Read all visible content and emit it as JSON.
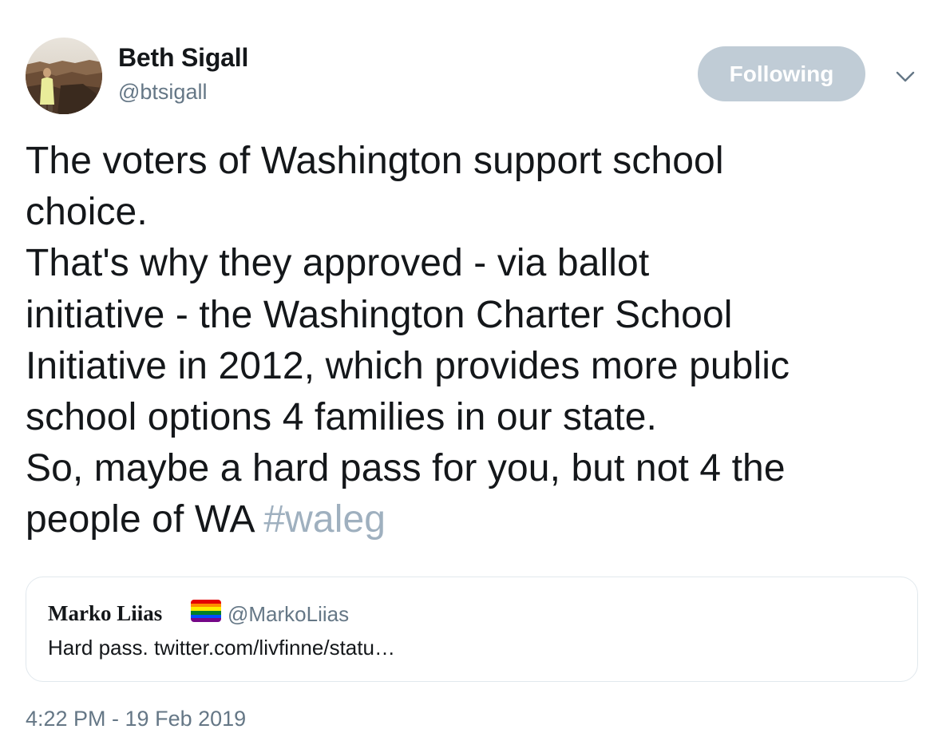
{
  "author": {
    "name": "Beth Sigall",
    "handle": "@btsigall"
  },
  "follow_button": {
    "label": "Following"
  },
  "menu": {
    "icon": "chevron-down-icon"
  },
  "tweet": {
    "lines": [
      "The voters of Washington support school",
      "choice.",
      "That's why they approved - via ballot",
      "initiative - the Washington Charter School",
      "Initiative in 2012, which provides more public",
      "school options 4 families in our state.",
      "So, maybe a hard pass for you, but not 4 the"
    ],
    "last_line_text": "people of WA ",
    "hashtag": "#waleg"
  },
  "quoted_tweet": {
    "name": "Marko Liias",
    "flag_icon": "rainbow-flag-icon",
    "handle": "@MarkoLiias",
    "text": "Hard pass. twitter.com/livfinne/statu…"
  },
  "timestamp": "4:22 PM - 19 Feb 2019",
  "colors": {
    "text": "#14171a",
    "secondary": "#657786",
    "hashtag": "#9fb0bf",
    "following_button": "#c0ccd6",
    "border": "#e1e8ed"
  }
}
